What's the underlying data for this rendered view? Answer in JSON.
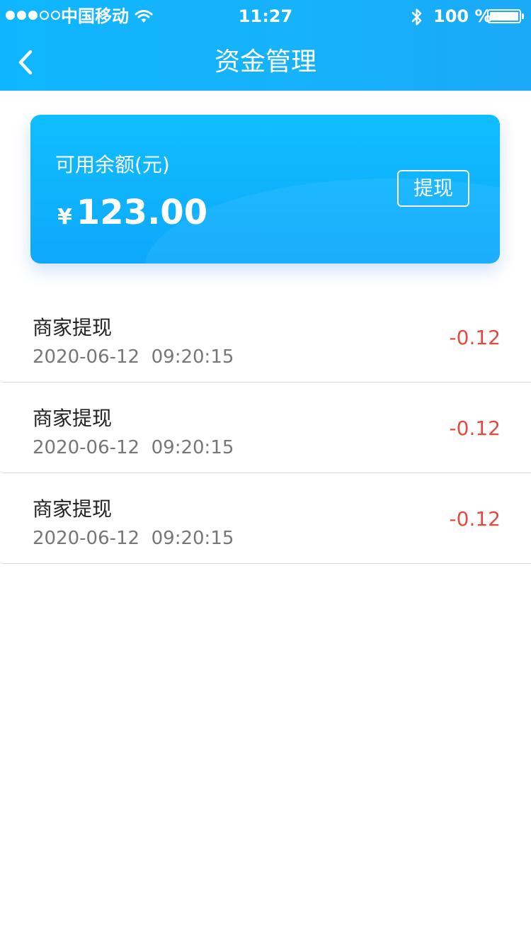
{
  "status_bar": {
    "carrier": "中国移动",
    "time": "11:27",
    "battery": "100 %",
    "signal_bars_filled": 3,
    "signal_bars_total": 5
  },
  "nav": {
    "title": "资金管理",
    "back_icon": "chevron-left-icon"
  },
  "balance_card": {
    "label": "可用余额(元)",
    "currency": "¥",
    "amount": "123.00",
    "withdraw_label": "提现"
  },
  "transactions": [
    {
      "title": "商家提现",
      "time": "2020-06-12  09:20:15",
      "amount": "-0.12"
    },
    {
      "title": "商家提现",
      "time": "2020-06-12  09:20:15",
      "amount": "-0.12"
    },
    {
      "title": "商家提现",
      "time": "2020-06-12  09:20:15",
      "amount": "-0.12"
    }
  ],
  "colors": {
    "header_blue": "#16b2fb",
    "card_blue": "#10beff",
    "negative_amount": "#e8483f"
  }
}
